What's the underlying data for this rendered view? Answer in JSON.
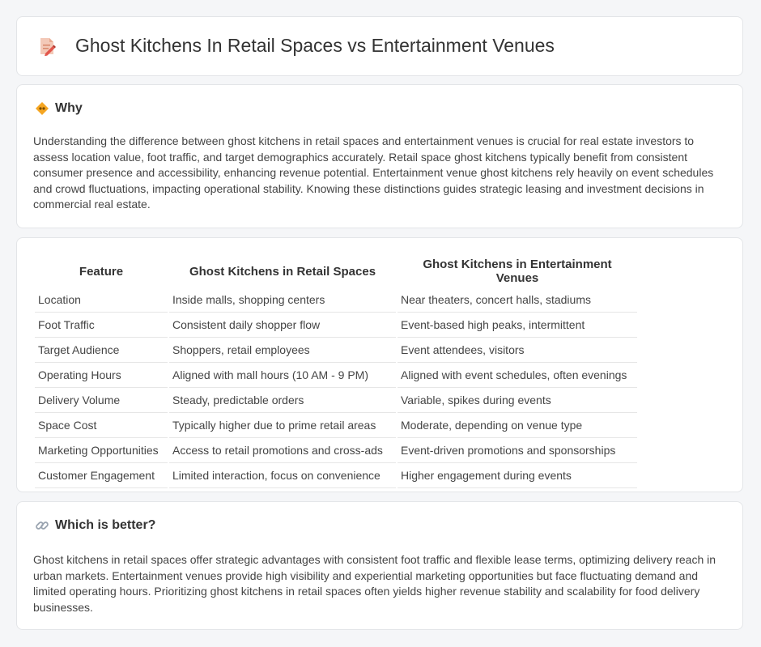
{
  "header": {
    "title": "Ghost Kitchens In Retail Spaces vs Entertainment Venues"
  },
  "why": {
    "title": "Why",
    "text": "Understanding the difference between ghost kitchens in retail spaces and entertainment venues is crucial for real estate investors to assess location value, foot traffic, and target demographics accurately. Retail space ghost kitchens typically benefit from consistent consumer presence and accessibility, enhancing revenue potential. Entertainment venue ghost kitchens rely heavily on event schedules and crowd fluctuations, impacting operational stability. Knowing these distinctions guides strategic leasing and investment decisions in commercial real estate."
  },
  "table": {
    "headers": [
      "Feature",
      "Ghost Kitchens in Retail Spaces",
      "Ghost Kitchens in Entertainment Venues"
    ],
    "rows": [
      [
        "Location",
        "Inside malls, shopping centers",
        "Near theaters, concert halls, stadiums"
      ],
      [
        "Foot Traffic",
        "Consistent daily shopper flow",
        "Event-based high peaks, intermittent"
      ],
      [
        "Target Audience",
        "Shoppers, retail employees",
        "Event attendees, visitors"
      ],
      [
        "Operating Hours",
        "Aligned with mall hours (10 AM - 9 PM)",
        "Aligned with event schedules, often evenings"
      ],
      [
        "Delivery Volume",
        "Steady, predictable orders",
        "Variable, spikes during events"
      ],
      [
        "Space Cost",
        "Typically higher due to prime retail areas",
        "Moderate, depending on venue type"
      ],
      [
        "Marketing Opportunities",
        "Access to retail promotions and cross-ads",
        "Event-driven promotions and sponsorships"
      ],
      [
        "Customer Engagement",
        "Limited interaction, focus on convenience",
        "Higher engagement during events"
      ]
    ]
  },
  "better": {
    "title": "Which is better?",
    "text": "Ghost kitchens in retail spaces offer strategic advantages with consistent foot traffic and flexible lease terms, optimizing delivery reach in urban markets. Entertainment venues provide high visibility and experiential marketing opportunities but face fluctuating demand and limited operating hours. Prioritizing ghost kitchens in retail spaces often yields higher revenue stability and scalability for food delivery businesses."
  }
}
